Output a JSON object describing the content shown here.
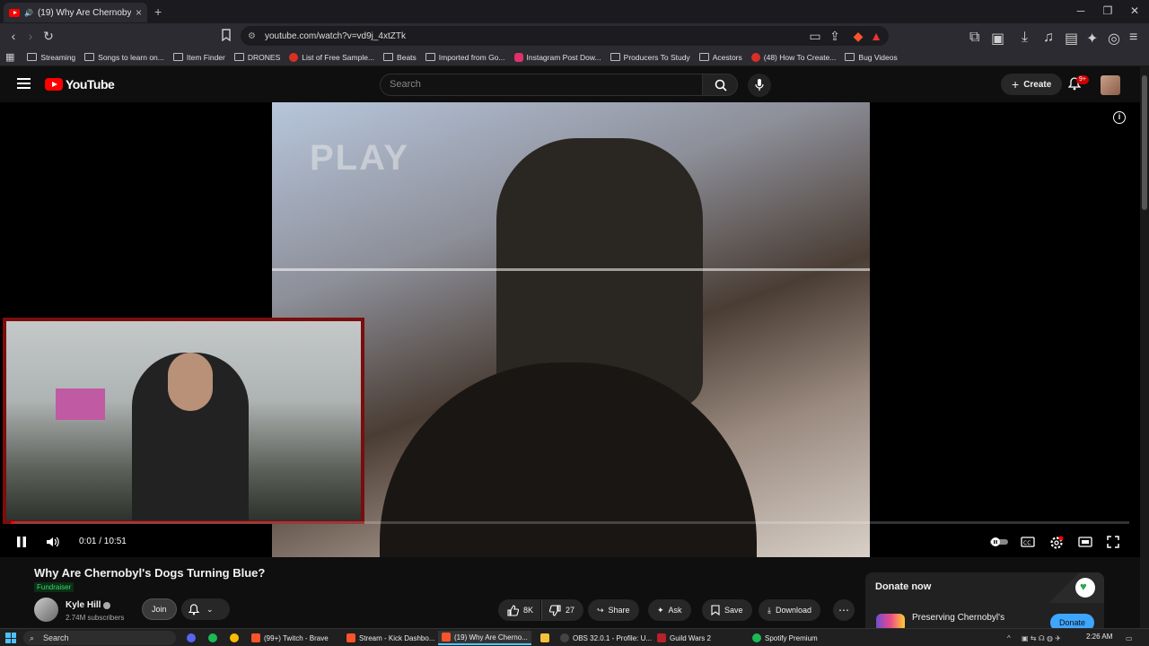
{
  "browser": {
    "tab_title": "(19) Why Are Chernobyl's Do",
    "url": "youtube.com/watch?v=vd9j_4xtZTk",
    "bookmarks": [
      {
        "label": "Streaming",
        "icon": "folder"
      },
      {
        "label": "Songs to learn on...",
        "icon": "folder"
      },
      {
        "label": "Item Finder",
        "icon": "folder"
      },
      {
        "label": "DRONES",
        "icon": "folder"
      },
      {
        "label": "List of Free Sample...",
        "icon": "red-circle"
      },
      {
        "label": "Beats",
        "icon": "folder"
      },
      {
        "label": "Imported from Go...",
        "icon": "folder"
      },
      {
        "label": "Instagram Post Dow...",
        "icon": "instagram"
      },
      {
        "label": "Producers To Study",
        "icon": "folder"
      },
      {
        "label": "Acestors",
        "icon": "folder"
      },
      {
        "label": "(48) How To Create...",
        "icon": "youtube"
      },
      {
        "label": "Bug Videos",
        "icon": "folder"
      }
    ]
  },
  "youtube": {
    "logo_text": "YouTube",
    "search_placeholder": "Search",
    "create_label": "Create",
    "notification_badge": "9+"
  },
  "player": {
    "osd_text": "PLAY",
    "current_time": "0:01 / 10:51",
    "progress_fraction": 0.002,
    "state": "playing"
  },
  "video": {
    "title": "Why Are Chernobyl's Dogs Turning Blue?",
    "badge": "Fundraiser",
    "channel_name": "Kyle Hill",
    "subscribers": "2.74M subscribers",
    "join_label": "Join",
    "actions": {
      "likes": "8K",
      "dislikes": "27",
      "share": "Share",
      "ask": "Ask",
      "save": "Save",
      "download": "Download"
    },
    "donate": {
      "header": "Donate now",
      "org": "Preserving Chernobyl's",
      "button": "Donate"
    }
  },
  "taskbar": {
    "search": "Search",
    "apps": [
      {
        "label": "(99+) Twitch - Brave",
        "color": "#9146ff",
        "active": false
      },
      {
        "label": "Stream - Kick Dashbo...",
        "color": "#53fc18",
        "active": false
      },
      {
        "label": "(19) Why Are Cherno...",
        "color": "#ff0000",
        "active": true
      },
      {
        "label": "OBS 32.0.1 - Profile: U...",
        "color": "#444444",
        "active": false
      },
      {
        "label": "Guild Wars 2",
        "color": "#b8202a",
        "active": false
      },
      {
        "label": "Spotify Premium",
        "color": "#1db954",
        "active": false
      }
    ],
    "clock": "2:26 AM"
  },
  "colors": {
    "accent": "#ff0000",
    "fundraiser_green": "#3fd36f",
    "donate_blue": "#3ea6ff"
  }
}
